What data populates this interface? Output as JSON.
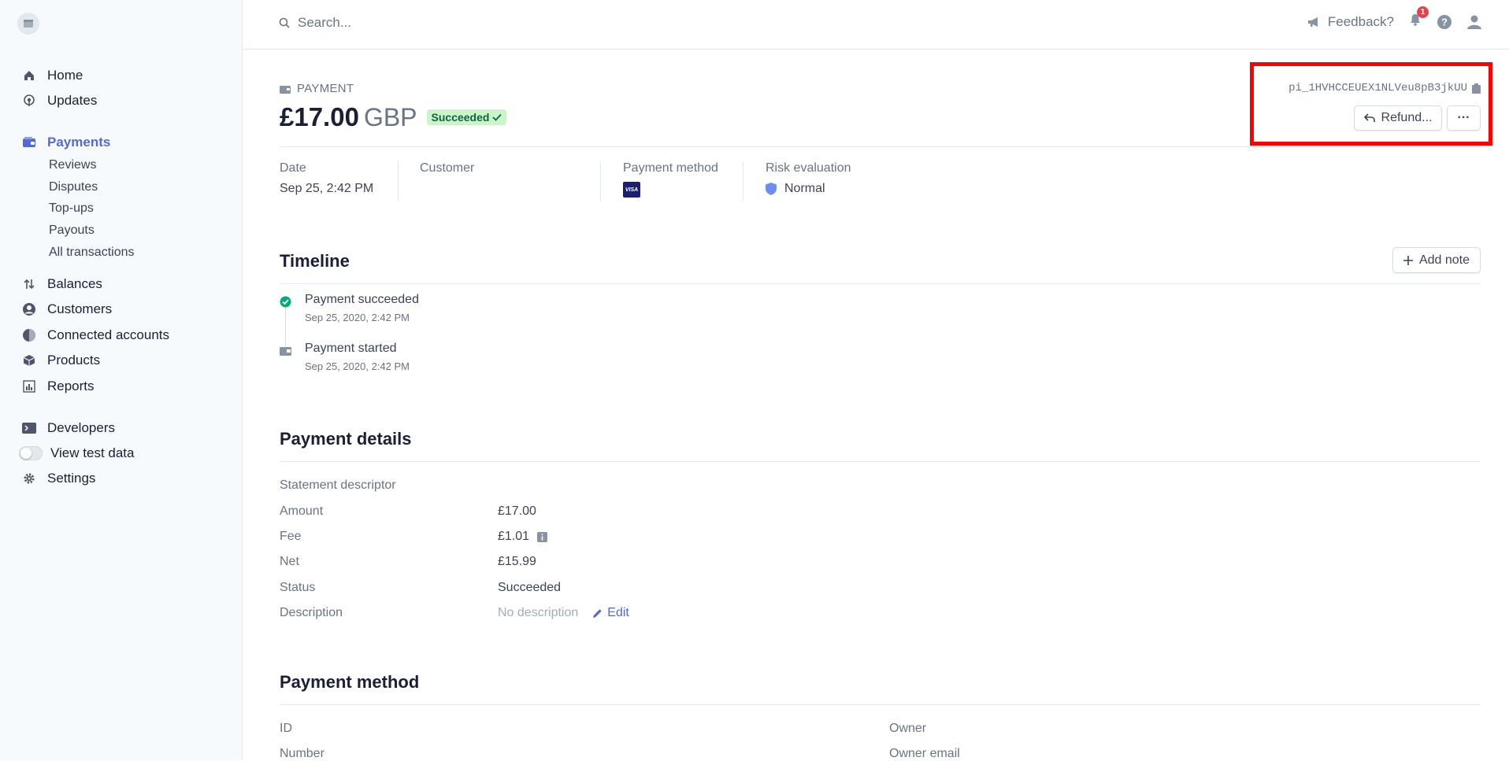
{
  "sidebar": {
    "items": [
      {
        "label": "Home",
        "icon": "home-icon"
      },
      {
        "label": "Updates",
        "icon": "broadcast-icon"
      },
      {
        "label": "Payments",
        "icon": "wallet-icon",
        "active": true
      },
      {
        "label": "Balances",
        "icon": "arrows-icon"
      },
      {
        "label": "Customers",
        "icon": "user-circle-icon"
      },
      {
        "label": "Connected accounts",
        "icon": "globe-icon"
      },
      {
        "label": "Products",
        "icon": "box-icon"
      },
      {
        "label": "Reports",
        "icon": "chart-icon"
      },
      {
        "label": "Developers",
        "icon": "terminal-icon"
      },
      {
        "label": "View test data",
        "icon": "toggle-icon"
      },
      {
        "label": "Settings",
        "icon": "gear-icon"
      }
    ],
    "sub_items": [
      "Reviews",
      "Disputes",
      "Top-ups",
      "Payouts",
      "All transactions"
    ]
  },
  "topbar": {
    "search_placeholder": "Search...",
    "feedback_label": "Feedback?",
    "notification_count": "1"
  },
  "payment": {
    "kind_label": "PAYMENT",
    "amount": "£17.00",
    "currency": "GBP",
    "status": "Succeeded",
    "id": "pi_1HVHCCEUEX1NLVeu8pB3jkUU",
    "refund_label": "Refund...",
    "more_label": "···"
  },
  "summary": {
    "date_label": "Date",
    "date_value": "Sep 25, 2:42 PM",
    "customer_label": "Customer",
    "method_label": "Payment method",
    "method_brand": "VISA",
    "risk_label": "Risk evaluation",
    "risk_value": "Normal"
  },
  "timeline": {
    "title": "Timeline",
    "add_note_label": "Add note",
    "events": [
      {
        "title": "Payment succeeded",
        "time": "Sep 25, 2020, 2:42 PM"
      },
      {
        "title": "Payment started",
        "time": "Sep 25, 2020, 2:42 PM"
      }
    ]
  },
  "details": {
    "title": "Payment details",
    "rows": [
      {
        "label": "Statement descriptor",
        "value": ""
      },
      {
        "label": "Amount",
        "value": "£17.00"
      },
      {
        "label": "Fee",
        "value": "£1.01"
      },
      {
        "label": "Net",
        "value": "£15.99"
      },
      {
        "label": "Status",
        "value": "Succeeded"
      },
      {
        "label": "Description",
        "value": "No description"
      }
    ],
    "edit_label": "Edit"
  },
  "method_section": {
    "title": "Payment method",
    "left_labels": [
      "ID",
      "Number"
    ],
    "right_labels": [
      "Owner",
      "Owner email"
    ]
  },
  "colors": {
    "accent": "#5469d4",
    "success_bg": "#cbf4c9",
    "success_text": "#0e6245",
    "highlight": "#ff0000"
  }
}
